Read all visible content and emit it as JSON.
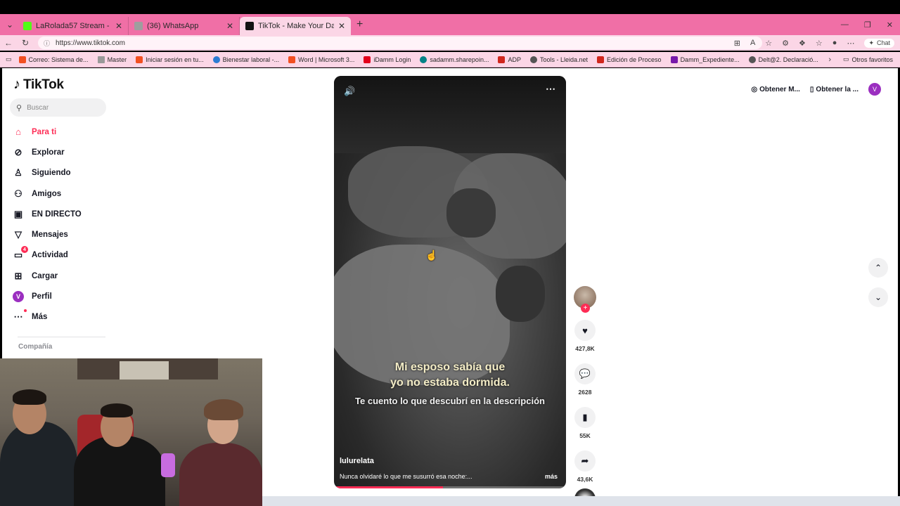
{
  "browser": {
    "tabs": [
      {
        "title": "LaRolada57 Stream - Watch Live o",
        "favicon_color": "#53fc18",
        "active": false
      },
      {
        "title": "(36) WhatsApp",
        "favicon_color": "#9e9e9e",
        "active": false
      },
      {
        "title": "TikTok - Make Your Day",
        "favicon_color": "#111111",
        "active": true
      }
    ],
    "new_tab": "+",
    "url": "https://www.tiktok.com",
    "chat_label": "Chat",
    "bookmarks": [
      {
        "label": "Correo: Sistema de...",
        "color": "#f25022"
      },
      {
        "label": "Master",
        "color": "#999999"
      },
      {
        "label": "Iniciar sesión en tu...",
        "color": "#f25022"
      },
      {
        "label": "Bienestar laboral -...",
        "color": "#2b7cd3"
      },
      {
        "label": "Word | Microsoft 3...",
        "color": "#f25022"
      },
      {
        "label": "iDamm Login",
        "color": "#e3001b"
      },
      {
        "label": "sadamm.sharepoin...",
        "color": "#038387"
      },
      {
        "label": "ADP",
        "color": "#d0271d"
      },
      {
        "label": "Tools - Lleida.net",
        "color": "#555555"
      },
      {
        "label": "Edición de Proceso",
        "color": "#d0271d"
      },
      {
        "label": "Damm_Expediente...",
        "color": "#7719aa"
      },
      {
        "label": "Delt@2. Declaració...",
        "color": "#555555"
      }
    ],
    "other_bookmarks": "Otros favoritos"
  },
  "tiktok": {
    "brand": "TikTok",
    "search_placeholder": "Buscar",
    "nav": [
      {
        "label": "Para ti",
        "icon": "home-icon",
        "glyph": "⌂"
      },
      {
        "label": "Explorar",
        "icon": "compass-icon",
        "glyph": "⊘"
      },
      {
        "label": "Siguiendo",
        "icon": "following-icon",
        "glyph": "♙"
      },
      {
        "label": "Amigos",
        "icon": "friends-icon",
        "glyph": "⚇"
      },
      {
        "label": "EN DIRECTO",
        "icon": "live-icon",
        "glyph": "▣"
      },
      {
        "label": "Mensajes",
        "icon": "messages-icon",
        "glyph": "▽"
      },
      {
        "label": "Actividad",
        "icon": "activity-icon",
        "glyph": "▭",
        "badge": "4"
      },
      {
        "label": "Cargar",
        "icon": "upload-icon",
        "glyph": "⊞"
      },
      {
        "label": "Perfil",
        "icon": "profile-avatar",
        "avatar_letter": "V"
      },
      {
        "label": "Más",
        "icon": "more-icon",
        "glyph": "⋯"
      }
    ],
    "company": "Compañía",
    "top_buttons": [
      "Obtener M...",
      "Obtener la ..."
    ],
    "profile_letter": "V",
    "video": {
      "caption_line1": "Mi esposo sabía que",
      "caption_line2": "yo no estaba dormida.",
      "caption_line3": "Te cuento lo que descubrí en la descripción",
      "username": "lulurelata",
      "description": "Nunca olvidaré lo que me susurró esa noche:...",
      "more": "más",
      "progress": 0.47
    },
    "actions": {
      "likes": "427,8K",
      "comments": "2628",
      "saves": "55K",
      "shares": "43,6K"
    }
  }
}
